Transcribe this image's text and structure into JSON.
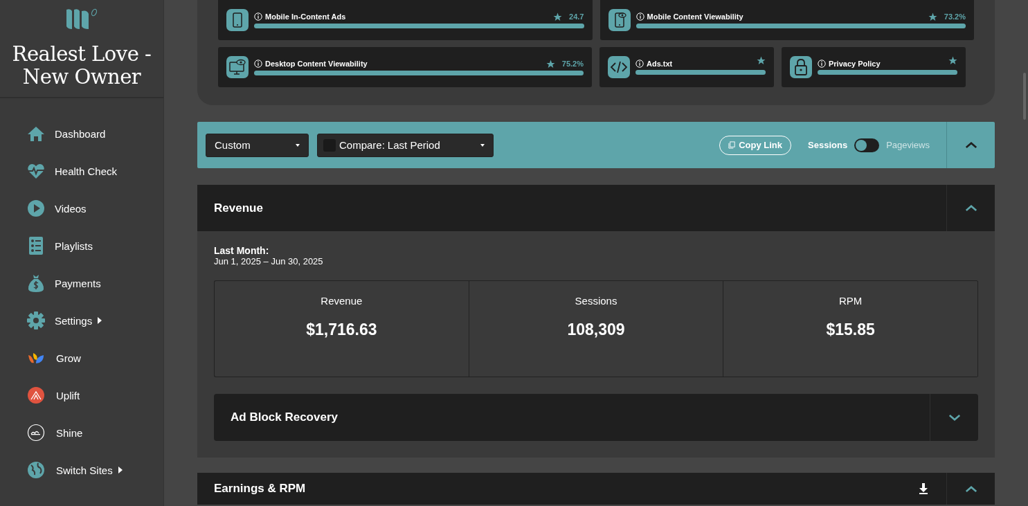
{
  "sidebar": {
    "site_title": "Realest Love - New Owner",
    "items": [
      {
        "label": "Dashboard",
        "submenu": false
      },
      {
        "label": "Health Check",
        "submenu": false
      },
      {
        "label": "Videos",
        "submenu": false
      },
      {
        "label": "Playlists",
        "submenu": false
      },
      {
        "label": "Payments",
        "submenu": false
      },
      {
        "label": "Settings",
        "submenu": true
      },
      {
        "label": "Grow",
        "submenu": false
      },
      {
        "label": "Uplift",
        "submenu": false
      },
      {
        "label": "Shine",
        "submenu": false
      },
      {
        "label": "Switch Sites",
        "submenu": true
      }
    ]
  },
  "scorecards": [
    {
      "title": "Mobile In-Content Ads",
      "value": "24.7",
      "level": 1
    },
    {
      "title": "Mobile Content Viewability",
      "value": "73.2%",
      "level": 1
    },
    {
      "title": "Desktop Content Viewability",
      "value": "75.2%",
      "level": 1
    },
    {
      "title": "Ads.txt",
      "level": 1
    },
    {
      "title": "Privacy Policy",
      "level": 1
    }
  ],
  "toolbar": {
    "date_range": "Custom",
    "compare": {
      "label": "Compare:",
      "value": "Last Period",
      "checked": false
    },
    "copy_link": "Copy Link",
    "toggle": {
      "left": "Sessions",
      "right": "Pageviews",
      "on": false
    },
    "expanded": true
  },
  "revenue": {
    "title": "Revenue",
    "expanded": true,
    "period_label": "Last Month:",
    "period_dates": "Jun 1, 2025 – Jun 30, 2025",
    "metrics": [
      {
        "label": "Revenue",
        "value": "$1,716.63"
      },
      {
        "label": "Sessions",
        "value": "108,309"
      },
      {
        "label": "RPM",
        "value": "$15.85"
      }
    ],
    "subsection": {
      "title": "Ad Block Recovery",
      "expanded": false
    }
  },
  "earnings": {
    "title": "Earnings & RPM",
    "expanded": true
  }
}
